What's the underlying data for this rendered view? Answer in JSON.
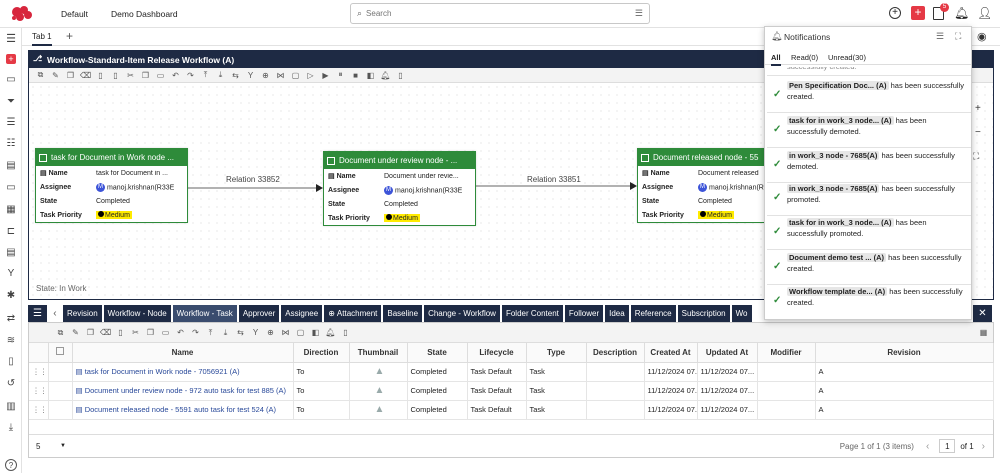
{
  "header": {
    "default_label": "Default",
    "dashboard_label": "Demo Dashboard",
    "search_placeholder": "Search",
    "notif_badge": "5"
  },
  "tab_bar": {
    "tab1": "Tab 1",
    "add": "+"
  },
  "workflow": {
    "title": "Workflow-Standard-Item Release Workflow (A)",
    "state_label": "State: In Work",
    "nodes": [
      {
        "title": "task for Document in Work node ...",
        "name_label": "Name",
        "name": "task for Document in ...",
        "assignee_label": "Assignee",
        "assignee": "manoj.krishnan(R33E",
        "avatar": "M",
        "state_label": "State",
        "state": "Completed",
        "priority_label": "Task Priority",
        "priority": "Medium"
      },
      {
        "title": "Document under review node - ...",
        "name_label": "Name",
        "name": "Document under revie...",
        "assignee_label": "Assignee",
        "assignee": "manoj.krishnan(R33E",
        "avatar": "M",
        "state_label": "State",
        "state": "Completed",
        "priority_label": "Task Priority",
        "priority": "Medium"
      },
      {
        "title": "Document released node - 55",
        "name_label": "Name",
        "name": "Document released",
        "assignee_label": "Assignee",
        "assignee": "manoj.krishnan(R3",
        "avatar": "M",
        "state_label": "State",
        "state": "Completed",
        "priority_label": "Task Priority",
        "priority": "Medium"
      }
    ],
    "relations": [
      "Relation 33852",
      "Relation 33851"
    ]
  },
  "bottom_tabs": [
    "Revision",
    "Workflow - Node",
    "Workflow - Task",
    "Approver",
    "Assignee",
    "Attachment",
    "Baseline",
    "Change - Workflow",
    "Folder Content",
    "Follower",
    "Idea",
    "Reference",
    "Subscription",
    "Wo"
  ],
  "grid": {
    "columns": [
      "Name",
      "Direction",
      "Thumbnail",
      "State",
      "Lifecycle",
      "Type",
      "Description",
      "Created At",
      "Updated At",
      "Modifier",
      "Revision"
    ],
    "rows": [
      {
        "name": "task for Document in Work node - 7056921 (A)",
        "direction": "To",
        "state": "Completed",
        "lifecycle": "Task Default",
        "type": "Task",
        "description": "",
        "created": "11/12/2024 07...",
        "updated": "11/12/2024 07...",
        "modifier": "",
        "revision": "A"
      },
      {
        "name": "Document under review node - 972 auto task for test 885 (A)",
        "direction": "To",
        "state": "Completed",
        "lifecycle": "Task Default",
        "type": "Task",
        "description": "",
        "created": "11/12/2024 07...",
        "updated": "11/12/2024 07...",
        "modifier": "",
        "revision": "A"
      },
      {
        "name": "Document released node - 5591 auto task for test 524 (A)",
        "direction": "To",
        "state": "Completed",
        "lifecycle": "Task Default",
        "type": "Task",
        "description": "",
        "created": "11/12/2024 07...",
        "updated": "11/12/2024 07...",
        "modifier": "",
        "revision": "A"
      }
    ],
    "page_size": "5",
    "page_info": "Page 1 of 1 (3 items)",
    "page_num": "1",
    "page_total": "of 1"
  },
  "notifications": {
    "title": "Notifications",
    "tabs": [
      "All",
      "Read(0)",
      "Unread(30)"
    ],
    "items": [
      {
        "pill": "Pen Specification Doc... (A)",
        "text": "has been successfully created."
      },
      {
        "pill": "task for in work_3 node... (A)",
        "text": "has been successfully demoted."
      },
      {
        "pill": "in work_3 node - 7685(A)",
        "text": "has been successfully demoted."
      },
      {
        "pill": "in work_3 node - 7685(A)",
        "text": "has been successfully promoted."
      },
      {
        "pill": "task for in work_3 node... (A)",
        "text": "has been successfully promoted."
      },
      {
        "pill": "Document demo test ... (A)",
        "text": "has been successfully created."
      },
      {
        "pill": "Workflow template de... (A)",
        "text": "has been successfully created."
      }
    ]
  }
}
